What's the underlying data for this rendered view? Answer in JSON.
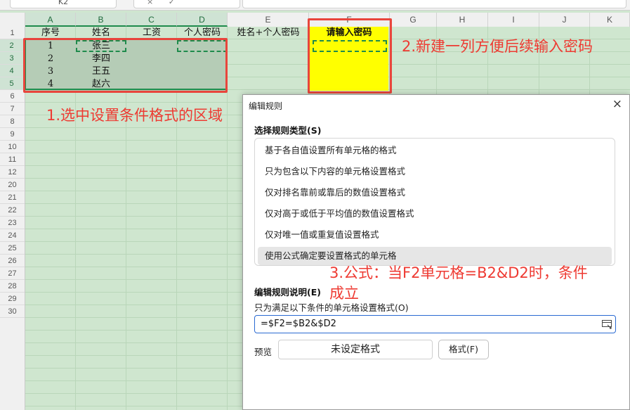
{
  "formula_bar": {
    "name_box": "K2",
    "icons": [
      "×",
      "✓"
    ]
  },
  "columns": [
    "A",
    "B",
    "C",
    "D",
    "E",
    "F",
    "G",
    "H",
    "I",
    "J",
    "K"
  ],
  "rows": [
    "1",
    "2",
    "3",
    "4",
    "5",
    "6",
    "7",
    "8",
    "9",
    "10",
    "11",
    "12",
    "20",
    "21",
    "22",
    "23",
    "24",
    "25",
    "26",
    "27",
    "28",
    "29",
    "30"
  ],
  "header_row": {
    "A": "序号",
    "B": "姓名",
    "C": "工资",
    "D": "个人密码",
    "E": "姓名+个人密码",
    "F": "请输入密码"
  },
  "data_rows": [
    {
      "A": "1",
      "B": "张三"
    },
    {
      "A": "2",
      "B": "李四"
    },
    {
      "A": "3",
      "B": "王五"
    },
    {
      "A": "4",
      "B": "赵六"
    }
  ],
  "annotations": {
    "step1": "1.选中设置条件格式的区域",
    "step2": "2.新建一列方便后续输入密码",
    "step3_line1": "3.公式：当F2单元格=B2&D2时，条件",
    "step3_line2": "成立"
  },
  "dialog": {
    "title": "编辑规则",
    "close": "×",
    "rule_type_label": "选择规则类型(S)",
    "rule_types": [
      "基于各自值设置所有单元格的格式",
      "只为包含以下内容的单元格设置格式",
      "仅对排名靠前或靠后的数值设置格式",
      "仅对高于或低于平均值的数值设置格式",
      "仅对唯一值或重复值设置格式",
      "使用公式确定要设置格式的单元格"
    ],
    "selected_rule_index": 5,
    "description_label": "编辑规则说明(E)",
    "formula_caption": "只为满足以下条件的单元格设置格式(O)",
    "formula": "=$F2=$B2&$D2",
    "preview_label": "预览",
    "preview_text": "未设定格式",
    "format_button": "格式(F)"
  },
  "colors": {
    "sheet_bg": "#cfe6cf",
    "selection": "#1f8b4c",
    "highlight": "#ffff00",
    "annotation": "#ee3a32"
  }
}
